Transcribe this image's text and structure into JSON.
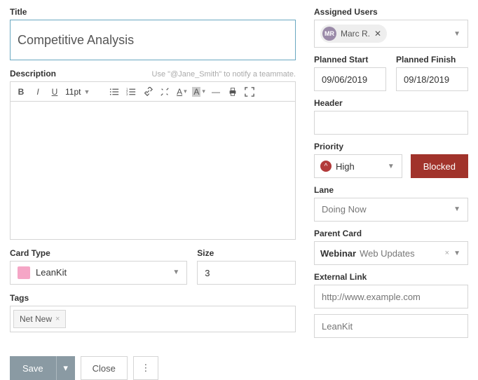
{
  "left": {
    "title_label": "Title",
    "title_value": "Competitive Analysis",
    "description_label": "Description",
    "description_hint": "Use \"@Jane_Smith\" to notify a teammate.",
    "toolbar": {
      "font_size": "11pt"
    },
    "card_type_label": "Card Type",
    "card_type_value": "LeanKit",
    "size_label": "Size",
    "size_value": "3",
    "tags_label": "Tags",
    "tag_value": "Net New",
    "save": "Save",
    "close": "Close"
  },
  "right": {
    "assigned_label": "Assigned Users",
    "user_initials": "MR",
    "user_name": "Marc R.",
    "planned_start_label": "Planned Start",
    "planned_start_value": "09/06/2019",
    "planned_finish_label": "Planned Finish",
    "planned_finish_value": "09/18/2019",
    "header_label": "Header",
    "header_value": "",
    "priority_label": "Priority",
    "priority_value": "High",
    "blocked_label": "Blocked",
    "lane_label": "Lane",
    "lane_value": "Doing Now",
    "parent_label": "Parent Card",
    "parent_bold": "Webinar",
    "parent_rest": "Web Updates",
    "external_label": "External Link",
    "external_url_placeholder": "http://www.example.com",
    "external_name_placeholder": "LeanKit"
  }
}
